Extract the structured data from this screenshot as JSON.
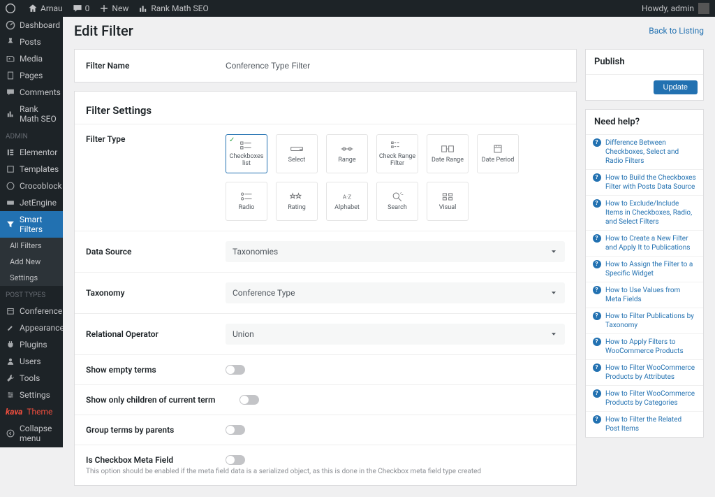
{
  "adminbar": {
    "site": "Arnau",
    "comments": "0",
    "new": "New",
    "seo": "Rank Math SEO",
    "howdy": "Howdy, admin"
  },
  "sidebar": {
    "items": [
      {
        "id": "dashboard",
        "label": "Dashboard",
        "icon": "dashboard"
      },
      {
        "id": "posts",
        "label": "Posts",
        "icon": "pin"
      },
      {
        "id": "media",
        "label": "Media",
        "icon": "media"
      },
      {
        "id": "pages",
        "label": "Pages",
        "icon": "pages"
      },
      {
        "id": "comments",
        "label": "Comments",
        "icon": "comment"
      },
      {
        "id": "rankmath",
        "label": "Rank Math SEO",
        "icon": "chart"
      },
      {
        "id": "elementor",
        "label": "Elementor",
        "icon": "elementor",
        "header_before": "Admin"
      },
      {
        "id": "templates",
        "label": "Templates",
        "icon": "templates"
      },
      {
        "id": "crocoblock",
        "label": "Crocoblock",
        "icon": "croco"
      },
      {
        "id": "jetengine",
        "label": "JetEngine",
        "icon": "jet"
      },
      {
        "id": "smartfilters",
        "label": "Smart Filters",
        "icon": "filter",
        "active": true
      },
      {
        "id": "conference",
        "label": "Conference",
        "icon": "calendar",
        "header_before": "Post Types"
      },
      {
        "id": "appearance",
        "label": "Appearance",
        "icon": "brush"
      },
      {
        "id": "plugins",
        "label": "Plugins",
        "icon": "plug"
      },
      {
        "id": "users",
        "label": "Users",
        "icon": "user"
      },
      {
        "id": "tools",
        "label": "Tools",
        "icon": "wrench"
      },
      {
        "id": "settings",
        "label": "Settings",
        "icon": "settings"
      },
      {
        "id": "theme",
        "label": "Theme",
        "kava": true
      },
      {
        "id": "collapse",
        "label": "Collapse menu",
        "icon": "collapse"
      }
    ],
    "subitems": [
      {
        "label": "All Filters"
      },
      {
        "label": "Add New"
      },
      {
        "label": "Settings"
      }
    ]
  },
  "page": {
    "title": "Edit Filter",
    "back": "Back to Listing",
    "filter_name_label": "Filter Name",
    "filter_name_value": "Conference Type Filter",
    "settings_title": "Filter Settings",
    "filter_type_label": "Filter Type",
    "types": [
      {
        "label": "Checkboxes list",
        "sel": true
      },
      {
        "label": "Select"
      },
      {
        "label": "Range"
      },
      {
        "label": "Check Range Filter"
      },
      {
        "label": "Date Range"
      },
      {
        "label": "Date Period"
      },
      {
        "label": "Radio"
      },
      {
        "label": "Rating"
      },
      {
        "label": "Alphabet"
      },
      {
        "label": "Search"
      },
      {
        "label": "Visual"
      }
    ],
    "data_source_label": "Data Source",
    "data_source_value": "Taxonomies",
    "taxonomy_label": "Taxonomy",
    "taxonomy_value": "Conference Type",
    "relational_label": "Relational Operator",
    "relational_value": "Union",
    "show_empty": "Show empty terms",
    "show_children": "Show only children of current term",
    "group_parents": "Group terms by parents",
    "is_checkbox_meta": "Is Checkbox Meta Field",
    "is_checkbox_help": "This option should be enabled if the meta field data is a serialized object, as this is done in the Checkbox meta field type created"
  },
  "publish": {
    "title": "Publish",
    "update": "Update"
  },
  "help": {
    "title": "Need help?",
    "items": [
      "Difference Between Checkboxes, Select and Radio Filters",
      "How to Build the Checkboxes Filter with Posts Data Source",
      "How to Exclude/Include Items in Checkboxes, Radio, and Select Filters",
      "How to Create a New Filter and Apply It to Publications",
      "How to Assign the Filter to a Specific Widget",
      "How to Use Values from Meta Fields",
      "How to Filter Publications by Taxonomy",
      "How to Apply Filters to WooCommerce Products",
      "How to Filter WooCommerce Products by Attributes",
      "How to Filter WooCommerce Products by Categories",
      "How to Filter the Related Post Items"
    ]
  }
}
